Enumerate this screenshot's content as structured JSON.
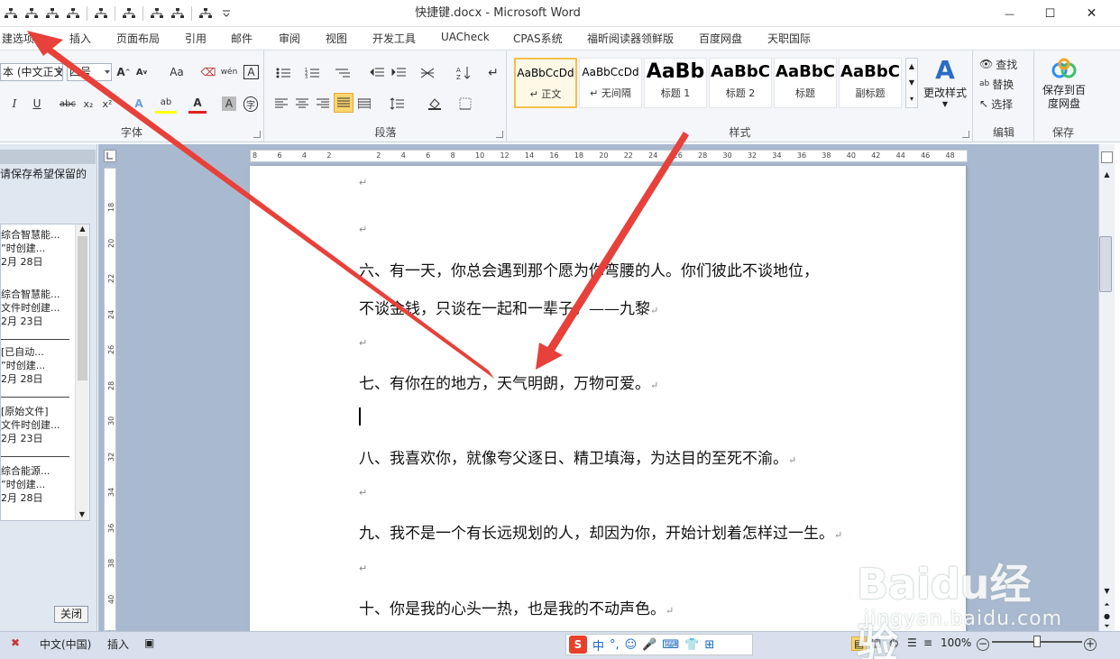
{
  "window": {
    "title": "快捷键.docx - Microsoft Word",
    "controls": {
      "minimize": "—",
      "maximize": "☐",
      "close": "✕"
    }
  },
  "tabs": [
    "建选项",
    "插入",
    "页面布局",
    "引用",
    "邮件",
    "审阅",
    "视图",
    "开发工具",
    "UACheck",
    "CPAS系统",
    "福昕阅读器领鲜版",
    "百度网盘",
    "天职国际"
  ],
  "ribbon": {
    "font": {
      "label": "字体",
      "font_name": "本 (中文正文",
      "font_size": "四号",
      "grow": "A",
      "shrink": "A",
      "case": "Aa",
      "clear": "⌫",
      "phonetic": "wén",
      "border": "A",
      "italic": "I",
      "underline": "U",
      "strike": "abc",
      "sub": "x₂",
      "sup": "x²",
      "effects": "A",
      "highlight": "ab",
      "color": "A",
      "shade": "A",
      "circle": "字"
    },
    "paragraph": {
      "label": "段落"
    },
    "styles": {
      "label": "样式",
      "items": [
        {
          "preview": "AaBbCcDd",
          "name": "↵ 正文"
        },
        {
          "preview": "AaBbCcDd",
          "name": "↵ 无间隔"
        },
        {
          "preview": "AaBb",
          "name": "标题 1"
        },
        {
          "preview": "AaBbC",
          "name": "标题 2"
        },
        {
          "preview": "AaBbC",
          "name": "标题"
        },
        {
          "preview": "AaBbC",
          "name": "副标题"
        }
      ],
      "change_styles": "更改样式"
    },
    "editing": {
      "label": "编辑",
      "find": "查找",
      "replace": "替换",
      "select": "选择"
    },
    "save": {
      "label": "保存",
      "save_baidu": "保存到百度网盘"
    }
  },
  "nav": {
    "message": "请保存希望保留的",
    "items": [
      {
        "line1": "综合智慧能...",
        "line2": "”时创建...",
        "line3": "2月 28日"
      },
      {
        "line1": "综合智慧能...",
        "line2": "文件时创建...",
        "line3": "2月 23日"
      },
      {
        "line1": "[已自动...",
        "line2": "”时创建...",
        "line3": "2月 28日"
      },
      {
        "line1": "[原始文件]",
        "line2": "文件时创建...",
        "line3": "2月 23日"
      },
      {
        "line1": "综合能源...",
        "line2": "”时创建...",
        "line3": "2月 28日"
      }
    ],
    "close": "关闭"
  },
  "ruler": {
    "h_ticks": [
      "8",
      "6",
      "4",
      "2",
      "",
      "2",
      "4",
      "6",
      "8",
      "10",
      "12",
      "14",
      "16",
      "18",
      "20",
      "22",
      "24",
      "26",
      "28",
      "30",
      "32",
      "34",
      "36",
      "38",
      "40",
      "42",
      "44",
      "46",
      "48"
    ],
    "v_ticks": [
      "18",
      "20",
      "22",
      "24",
      "26",
      "28",
      "30",
      "32",
      "34",
      "36",
      "38",
      "40",
      "42"
    ]
  },
  "document": {
    "paragraphs": [
      "六、有一天，你总会遇到那个愿为你弯腰的人。你们彼此不谈地位，",
      "不谈金钱，只谈在一起和一辈子。——九黎",
      "七、有你在的地方，天气明朗，万物可爱。",
      "八、我喜欢你，就像夸父逐日、精卫填海，为达目的至死不渝。",
      "九、我不是一个有长远规划的人，却因为你，开始计划着怎样过一生。",
      "十、你是我的心头一热，也是我的不动声色。"
    ],
    "para_mark": "↵"
  },
  "status": {
    "language": "中文(中国)",
    "mode": "插入",
    "zoom": "100%",
    "zoom_minus": "−",
    "zoom_plus": "+"
  },
  "ime": {
    "logo": "S",
    "lang": "中",
    "punct": "°,",
    "emoji": "☺",
    "mic": "🎤",
    "kb": "⌨",
    "skin": "👕",
    "grid": "⊞"
  },
  "watermark": {
    "logo": "Baidu经验",
    "url": "jingyan.baidu.com"
  },
  "colors": {
    "accent": "#2b579a",
    "arrow": "#e8403a",
    "highlight": "#f2c04a",
    "page_bg": "#a9b9cf"
  }
}
